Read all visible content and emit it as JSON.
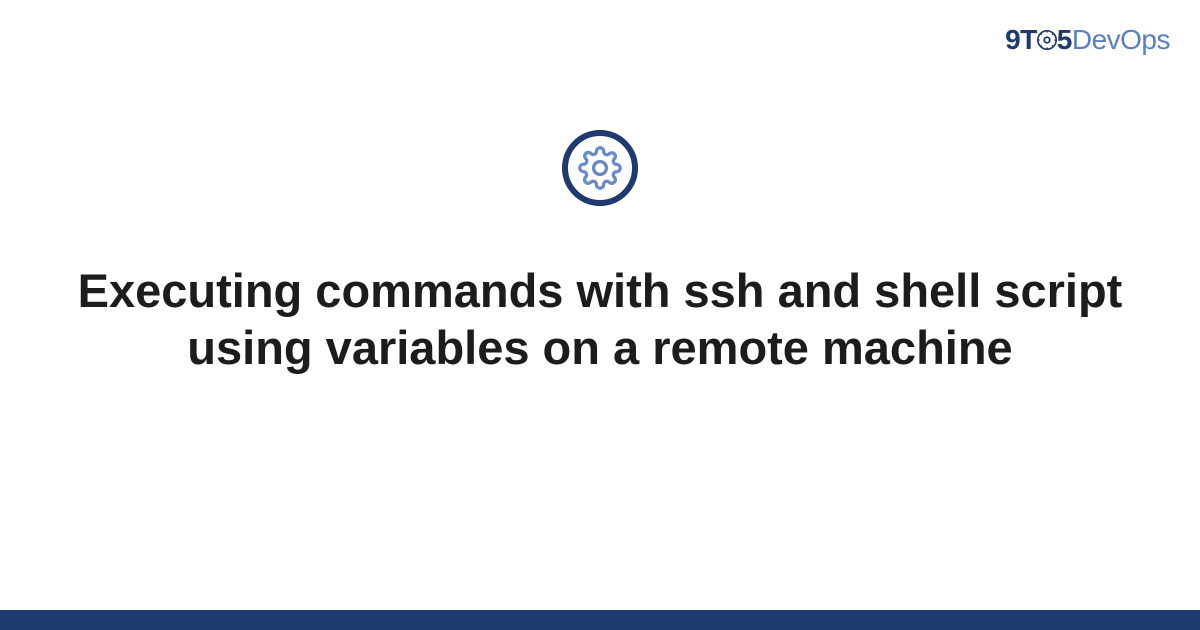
{
  "brand": {
    "part1": "9T",
    "part2": "5",
    "part3": "DevOps"
  },
  "title": "Executing commands with ssh and shell script using variables on a remote machine",
  "colors": {
    "brand_dark": "#1f3a6e",
    "brand_light": "#5a80c2",
    "text": "#1c1c1c"
  }
}
